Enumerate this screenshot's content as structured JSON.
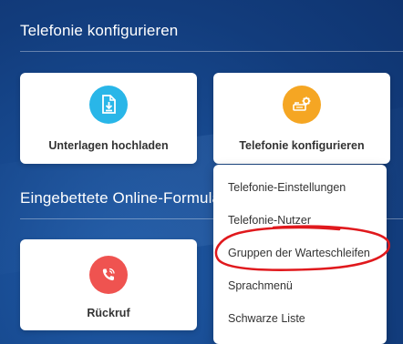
{
  "sections": [
    {
      "title": "Telefonie konfigurieren"
    },
    {
      "title": "Eingebettete Online-Formulare"
    }
  ],
  "cards": {
    "upload": {
      "label": "Unterlagen hochladen",
      "icon": "document-upload-icon",
      "color": "#29b6e8"
    },
    "telephony": {
      "label": "Telefonie konfigurieren",
      "icon": "phone-settings-icon",
      "color": "#f5a623"
    },
    "callback": {
      "label": "Rückruf",
      "icon": "phone-callback-icon",
      "color": "#ef5350"
    }
  },
  "dropdown": {
    "items": [
      "Telefonie-Einstellungen",
      "Telefonie-Nutzer",
      "Gruppen der Warteschleifen",
      "Sprachmenü",
      "Schwarze Liste"
    ]
  },
  "annotation": {
    "color": "#e0191d",
    "highlighted_item": "Gruppen der Warteschleifen"
  }
}
